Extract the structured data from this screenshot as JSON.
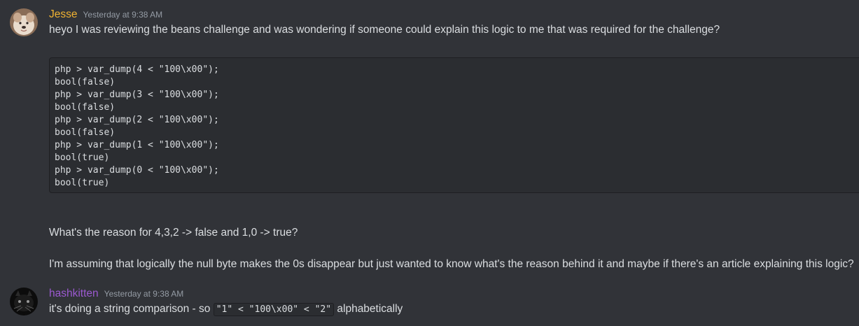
{
  "messages": [
    {
      "author": "Jesse",
      "author_color": "#f0b232",
      "timestamp": "Yesterday at 9:38 AM",
      "intro": "heyo I was reviewing the beans challenge and was wondering if someone could explain this logic to me that was required for the challenge?",
      "code_lines": [
        "php > var_dump(4 < \"100\\x00\");",
        "bool(false)",
        "php > var_dump(3 < \"100\\x00\");",
        "bool(false)",
        "php > var_dump(2 < \"100\\x00\");",
        "bool(false)",
        "php > var_dump(1 < \"100\\x00\");",
        "bool(true)",
        "php > var_dump(0 < \"100\\x00\");",
        "bool(true)"
      ],
      "question": "What's the reason for 4,3,2 -> false and 1,0 -> true?",
      "followup": "I'm assuming that logically the null byte makes the 0s disappear but just wanted to know what's the reason behind it and maybe if there's an article explaining this logic?"
    },
    {
      "author": "hashkitten",
      "author_color": "#9b59d0",
      "timestamp": "Yesterday at 9:38 AM",
      "text_before": "it's doing a string comparison - so ",
      "inline_code": "\"1\" < \"100\\x00\" < \"2\"",
      "text_after": " alphabetically"
    }
  ]
}
